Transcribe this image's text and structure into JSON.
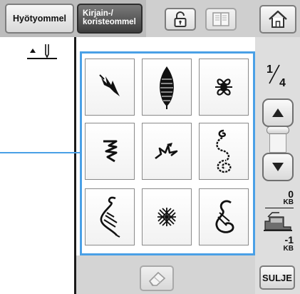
{
  "toolbar": {
    "utility_tab_label": "Hyötyommel",
    "decorative_tab_label_line1": "Kirjain-/",
    "decorative_tab_label_line2": "koristeommel",
    "lock_icon": "lock-icon",
    "book_icon": "book-icon",
    "home_icon": "home-icon"
  },
  "needle": {
    "icon": "needle-position-icon"
  },
  "stitch_grid": {
    "rows": 3,
    "columns": 3,
    "items": [
      {
        "name": "leaf-stitch-1"
      },
      {
        "name": "leaf-stitch-2"
      },
      {
        "name": "flower-stitch"
      },
      {
        "name": "wave-stitch"
      },
      {
        "name": "bird-stitch"
      },
      {
        "name": "spiral-stitch"
      },
      {
        "name": "swirl-stitch"
      },
      {
        "name": "cross-stitch"
      },
      {
        "name": "curl-stitch"
      }
    ]
  },
  "pagination": {
    "current": "1",
    "total": "4"
  },
  "memory": {
    "available_value": "0",
    "available_unit": "KB",
    "used_value": "-1",
    "used_unit": "KB"
  },
  "footer": {
    "eraser_icon": "eraser-icon",
    "close_label": "SULJE"
  },
  "colors": {
    "selection_frame": "#4aa0e6",
    "active_tab": "#4a4a4a"
  }
}
